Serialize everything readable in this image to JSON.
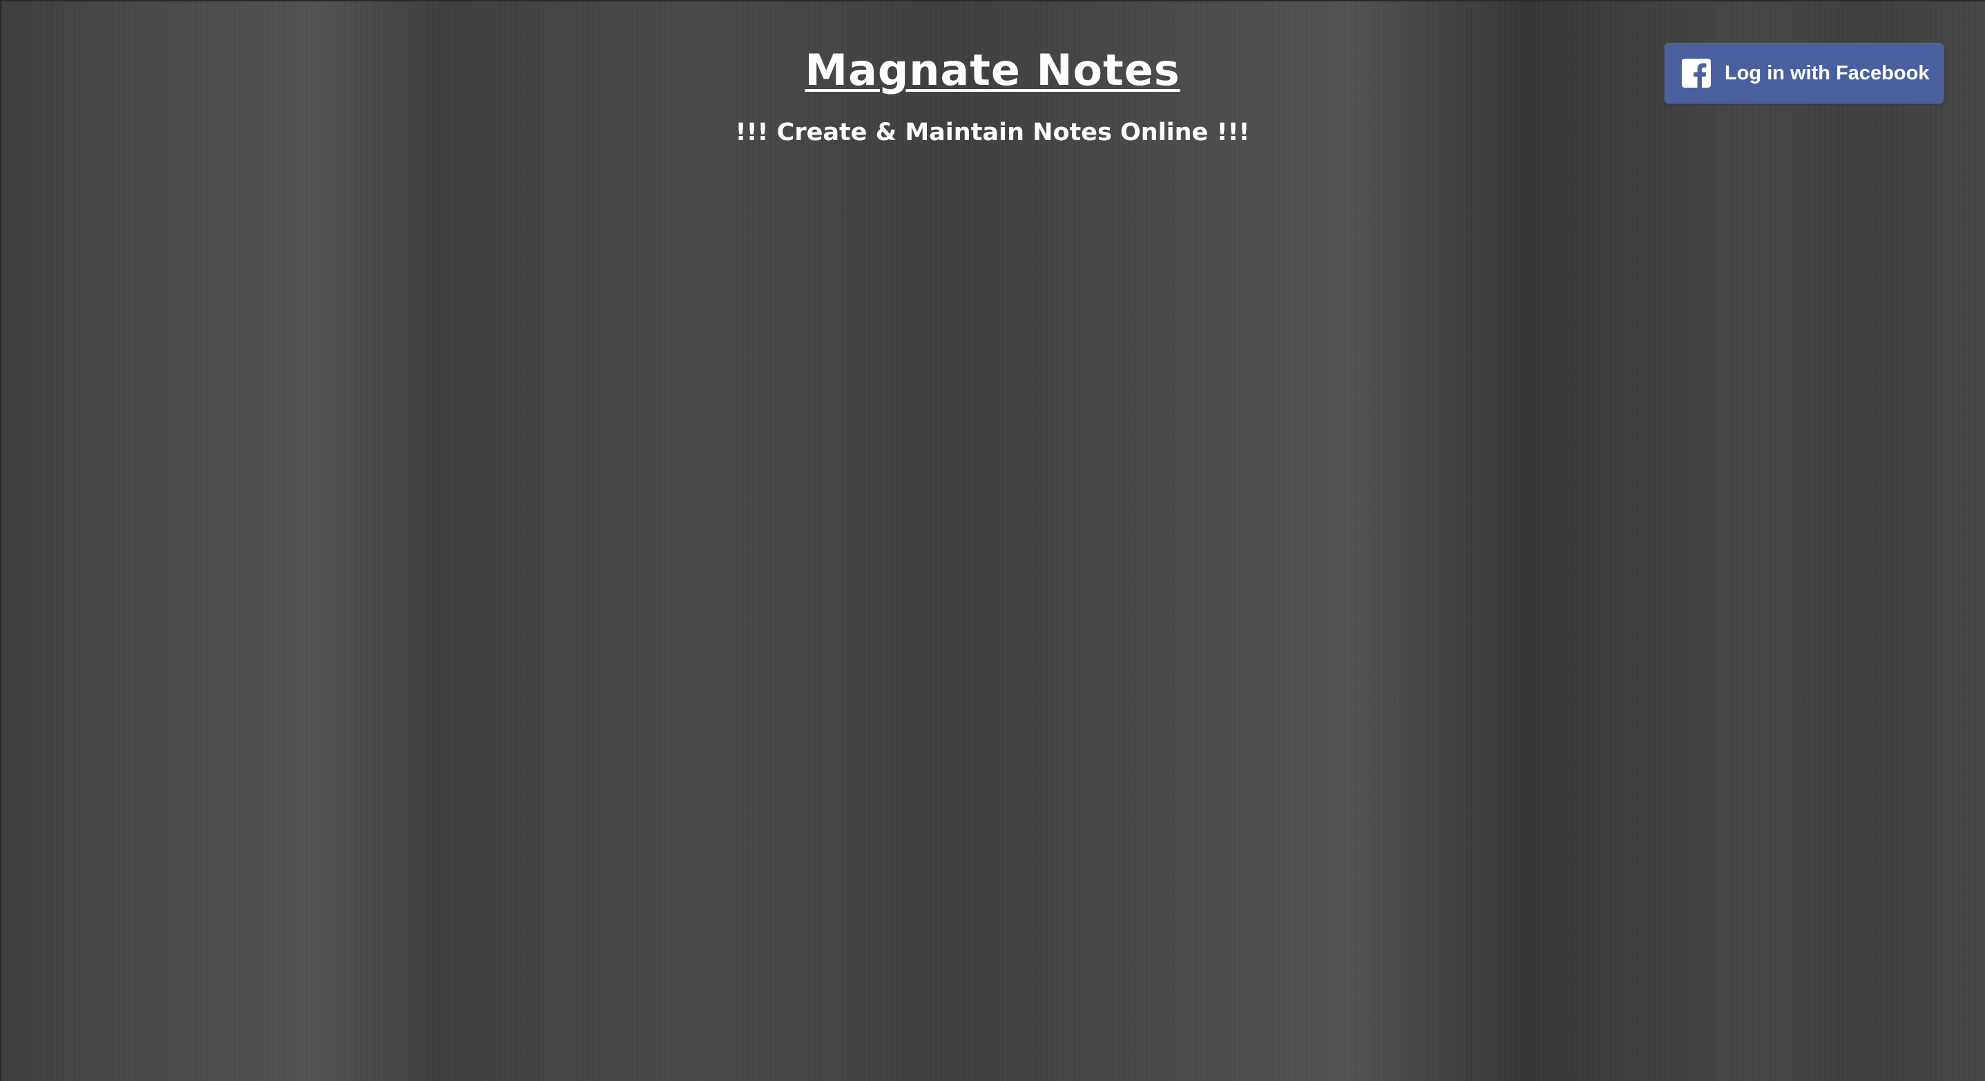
{
  "header": {
    "title": "Magnate Notes",
    "subtitle": "!!! Create & Maintain Notes Online !!!"
  },
  "facebook_login": {
    "label": "Log in with Facebook",
    "icon": "facebook-icon",
    "color": "#4a5f9d"
  },
  "colors": {
    "background": "#3d3d3d",
    "text": "#ffffff"
  }
}
